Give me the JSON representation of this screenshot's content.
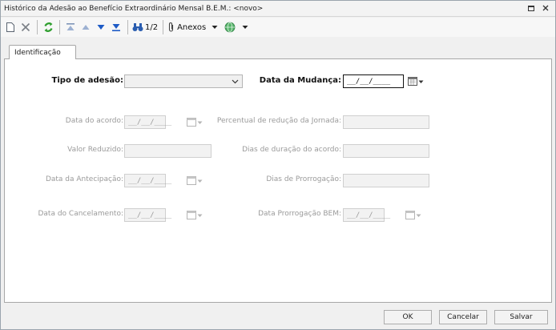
{
  "window": {
    "title": "Histórico da Adesão ao Benefício Extraordinário Mensal B.E.M.: <novo>"
  },
  "toolbar": {
    "page_indicator": "1/2",
    "attachments_label": "Anexos"
  },
  "tabs": [
    {
      "label": "Identificação"
    }
  ],
  "form": {
    "tipo_adesao": {
      "label": "Tipo de adesão:",
      "value": ""
    },
    "data_mudanca": {
      "label": "Data da Mudança:",
      "value": "__/__/____"
    },
    "data_acordo": {
      "label": "Data do acordo:",
      "value": "__/__/____"
    },
    "percentual_reducao": {
      "label": "Percentual de redução da Jornada:",
      "value": ""
    },
    "valor_reduzido": {
      "label": "Valor Reduzido:",
      "value": ""
    },
    "dias_duracao": {
      "label": "Dias de duração do acordo:",
      "value": ""
    },
    "data_antecipacao": {
      "label": "Data da Antecipação:",
      "value": "__/__/____"
    },
    "dias_prorrogacao": {
      "label": "Dias de Prorrogação:",
      "value": ""
    },
    "data_cancelamento": {
      "label": "Data do Cancelamento:",
      "value": "__/__/____"
    },
    "data_prorrogacao_bem": {
      "label": "Data Prorrogação BEM:",
      "value": "__/__/____"
    }
  },
  "footer": {
    "ok_label": "OK",
    "cancel_label": "Cancelar",
    "save_label": "Salvar"
  },
  "colors": {
    "refresh_green": "#2e9e2e",
    "nav_blue": "#1e5bc6",
    "disabled_text": "#9a9a9a"
  }
}
